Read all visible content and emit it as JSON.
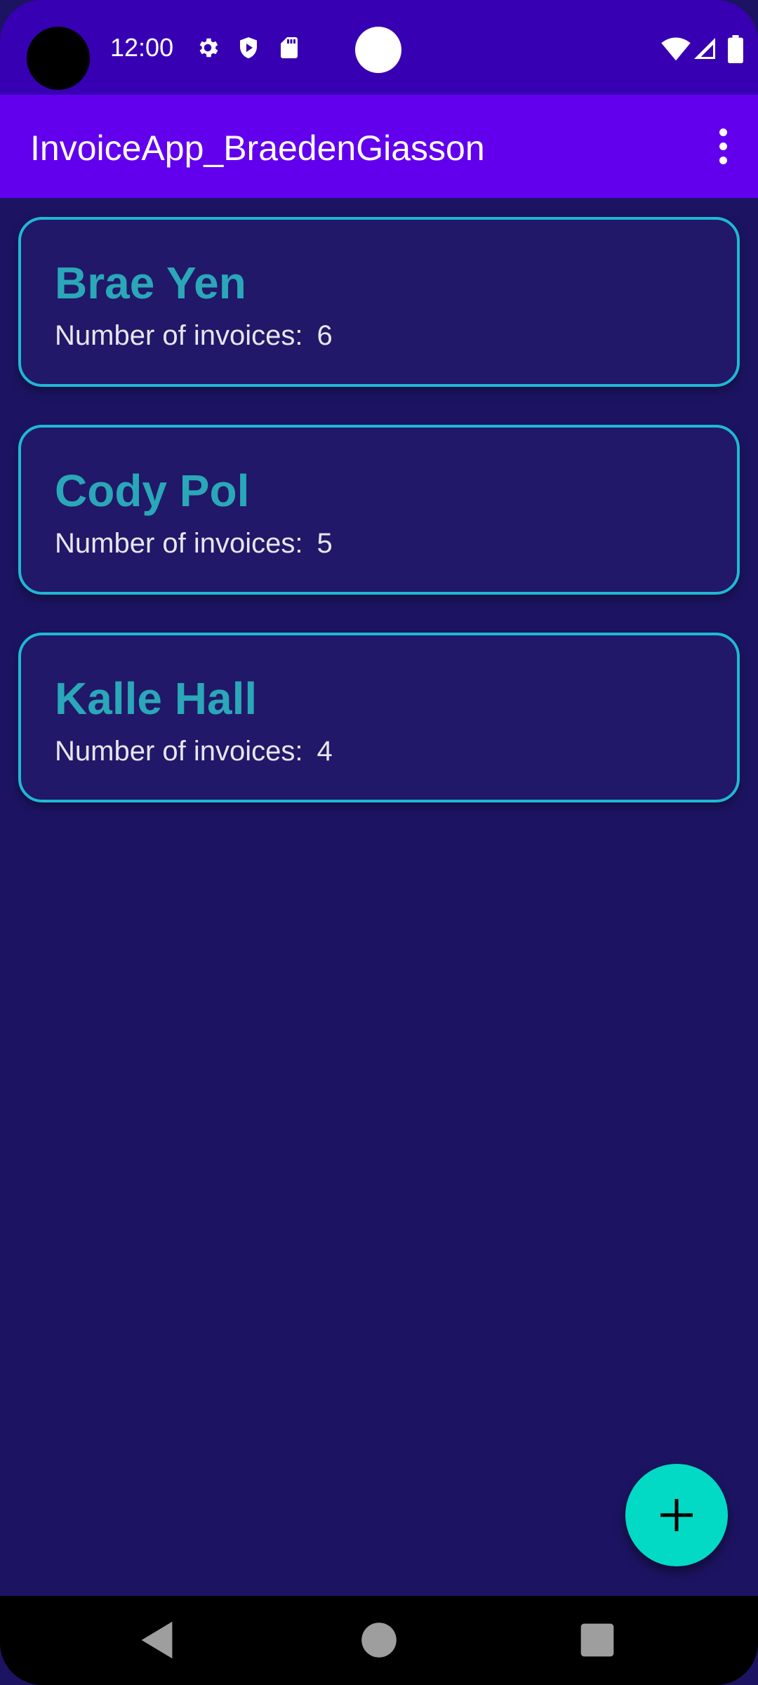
{
  "status_bar": {
    "time": "12:00",
    "icons": [
      "settings-icon",
      "shield-icon",
      "sd-card-icon",
      "wifi-icon",
      "signal-icon",
      "battery-icon"
    ]
  },
  "app_bar": {
    "title": "InvoiceApp_BraedenGiasson",
    "menu_icon": "more-vert-icon"
  },
  "customers": [
    {
      "name": "Brae Yen",
      "invoices_label": "Number of invoices:",
      "invoices_count": "6"
    },
    {
      "name": "Cody Pol",
      "invoices_label": "Number of invoices:",
      "invoices_count": "5"
    },
    {
      "name": "Kalle Hall",
      "invoices_label": "Number of invoices:",
      "invoices_count": "4"
    }
  ],
  "fab": {
    "icon": "plus-icon"
  },
  "nav_bar": {
    "icons": [
      "back-icon",
      "home-icon",
      "recents-icon"
    ]
  },
  "colors": {
    "status_bar": "#3800b3",
    "app_bar": "#6200ee",
    "background": "#1c1462",
    "card_border": "#1fb8d3",
    "name_text": "#2aa7b8",
    "fab": "#03dac5"
  }
}
